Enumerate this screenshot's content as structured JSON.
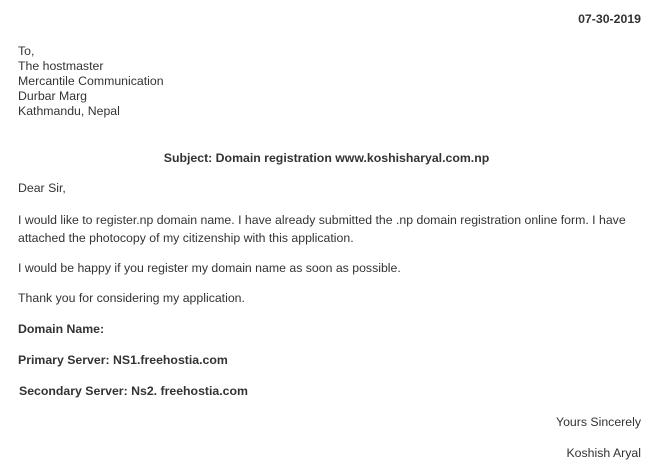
{
  "date": "07-30-2019",
  "address": [
    "To,",
    "The hostmaster",
    "Mercantile Communication",
    "Durbar Marg",
    "Kathmandu, Nepal"
  ],
  "subject": "Subject: Domain registration www.koshisharyal.com.np",
  "greeting": "Dear Sir,",
  "paragraphs": [
    "I would like to register.np domain name. I have already submitted the .np domain registration online form. I have attached the photocopy of my citizenship with this application.",
    "I would be happy if you register my domain name as soon as possible.",
    "Thank you for considering my application."
  ],
  "domain_name_label": "Domain Name:",
  "primary_server": "Primary Server: NS1.freehostia.com",
  "secondary_server": "Secondary Server: Ns2. freehostia.com",
  "closing": "Yours Sincerely",
  "signature": "Koshish Aryal"
}
